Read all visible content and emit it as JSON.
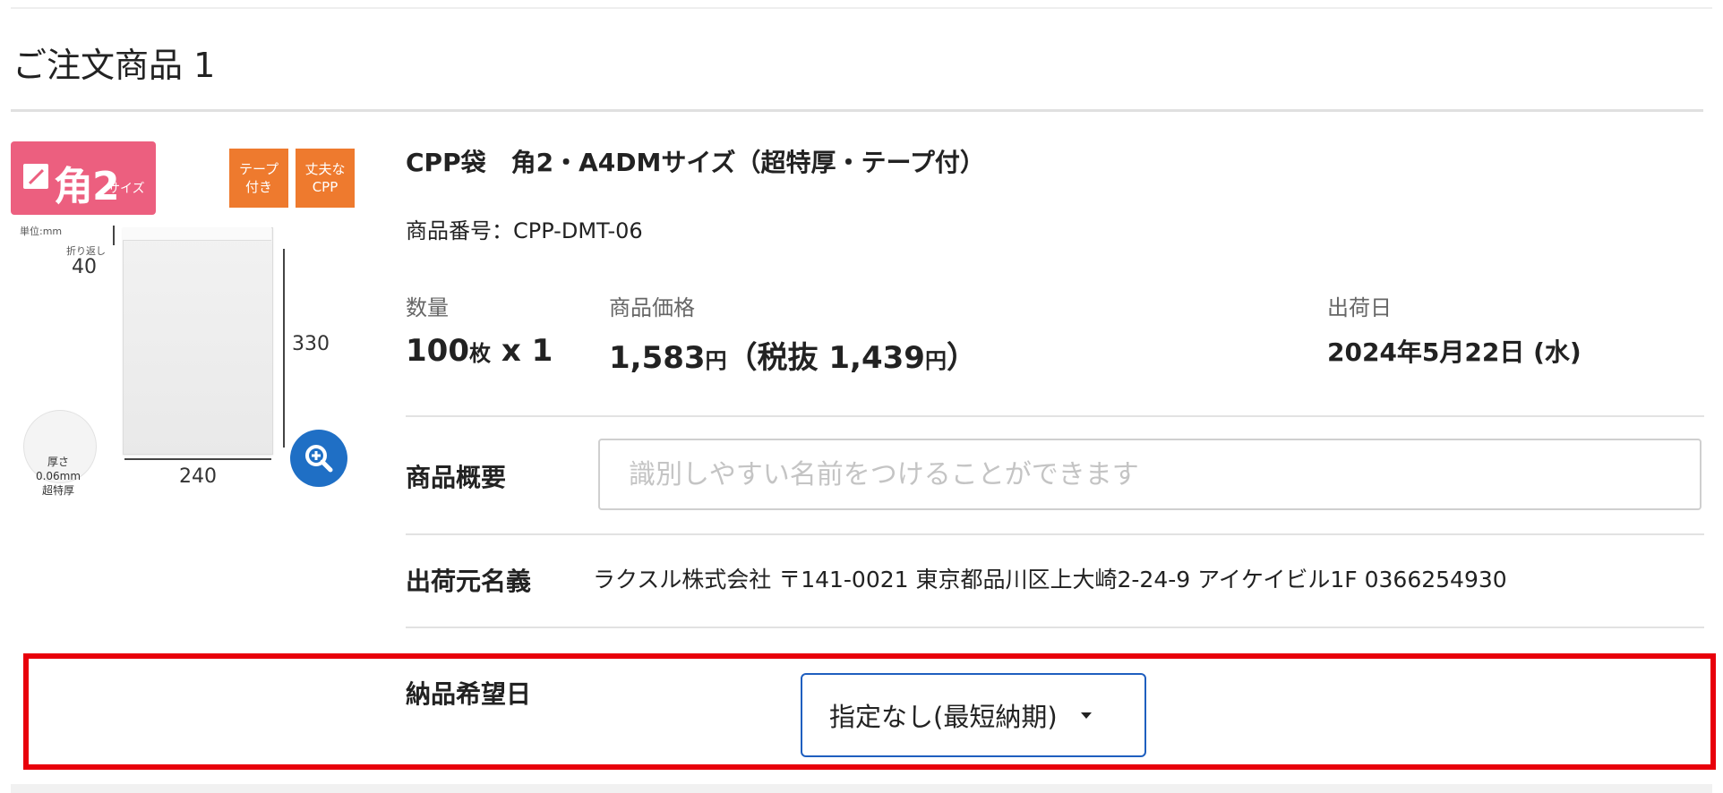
{
  "section": {
    "title": "ご注文商品 1"
  },
  "image": {
    "size_badge_main": "角2",
    "size_badge_sub": "サイズ",
    "tags": [
      "テープ\n付き",
      "丈夫な\nCPP"
    ],
    "unit_label": "単位:mm",
    "fold_label": "折り返し",
    "fold_value": "40",
    "height_value": "330",
    "width_value": "240",
    "thickness_label": "厚さ0.06mm\n超特厚"
  },
  "product": {
    "title": "CPP袋　角2・A4DMサイズ（超特厚・テープ付）",
    "code": "商品番号：CPP-DMT-06",
    "quantity_label": "数量",
    "quantity_num": "100",
    "quantity_unit": "枚",
    "quantity_mult": " x 1",
    "price_label": "商品価格",
    "price_value": "1,583",
    "price_unit": "円",
    "price_tax_prefix": "（税抜 ",
    "price_tax_value": "1,439",
    "price_tax_unit": "円",
    "price_tax_suffix": "）",
    "ship_label": "出荷日",
    "ship_value": "2024年5月22日 (水)"
  },
  "summary": {
    "label": "商品概要",
    "placeholder": "識別しやすい名前をつけることができます",
    "value": ""
  },
  "shipper": {
    "label": "出荷元名義",
    "value": "ラクスル株式会社 〒141-0021 東京都品川区上大崎2-24-9 アイケイビル1F 0366254930"
  },
  "delivery": {
    "label": "納品希望日",
    "selected": "指定なし(最短納期)"
  },
  "colors": {
    "badge_pink": "#ec5f7f",
    "tag_orange": "#ee7a2e",
    "zoom_blue": "#1f6fc5",
    "select_border": "#1f5fbf",
    "highlight_red": "#e8000b"
  },
  "icons": {
    "zoom": "zoom-in-icon",
    "dropdown": "caret-down-icon"
  }
}
